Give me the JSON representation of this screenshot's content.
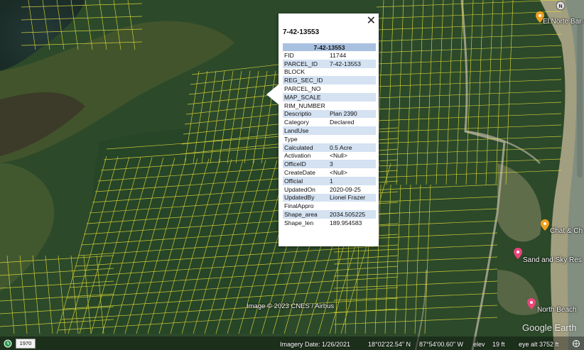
{
  "popup": {
    "title": "7-42-13553",
    "table_header": "7-42-13553",
    "close_glyph": "✕",
    "rows": [
      {
        "key": "FID",
        "value": "11744"
      },
      {
        "key": "PARCEL_ID",
        "value": "7-42-13553"
      },
      {
        "key": "BLOCK",
        "value": ""
      },
      {
        "key": "REG_SEC_ID",
        "value": ""
      },
      {
        "key": "PARCEL_NO",
        "value": ""
      },
      {
        "key": "MAP_SCALE",
        "value": ""
      },
      {
        "key": "RIM_NUMBER",
        "value": ""
      },
      {
        "key": "Descriptio",
        "value": "Plan 2390"
      },
      {
        "key": "Category",
        "value": "Declared"
      },
      {
        "key": "LandUse",
        "value": ""
      },
      {
        "key": "Type",
        "value": ""
      },
      {
        "key": "Calculated",
        "value": "0.5 Acre"
      },
      {
        "key": "Activation",
        "value": "<Null>"
      },
      {
        "key": "OfficeID",
        "value": "3"
      },
      {
        "key": "CreateDate",
        "value": "<Null>"
      },
      {
        "key": "Official",
        "value": "1"
      },
      {
        "key": "UpdatedOn",
        "value": "2020-09-25"
      },
      {
        "key": "UpdatedBy",
        "value": "Lionel Frazer"
      },
      {
        "key": "FinalAppro",
        "value": ""
      },
      {
        "key": "Shape_area",
        "value": "2034.505225"
      },
      {
        "key": "Shape_len",
        "value": "189.954583"
      }
    ]
  },
  "places": [
    {
      "name": "El Norte Bar &",
      "icon": "bar-pin-icon"
    },
    {
      "name": "Chat & Ch",
      "icon": "restaurant-pin-icon"
    },
    {
      "name": "Sand and Sky Res",
      "icon": "hotel-pin-icon"
    },
    {
      "name": "North Beach",
      "icon": "hotel-pin-icon"
    }
  ],
  "compass": {
    "north_label": "N"
  },
  "map": {
    "attribution": "Image © 2023 CNES / Airbus",
    "watermark": "Google Earth",
    "parcel_line_color": "#e8e33a",
    "pin_orange": "#f0a020",
    "pin_pink": "#e8457a"
  },
  "status": {
    "year": "1970",
    "imagery_date": "Imagery Date: 1/26/2021",
    "latitude": "18°02'22.54\" N",
    "longitude": "87°54'00.60\" W",
    "elev_label": "elev",
    "elev_value": "19 ft",
    "eye_alt": "eye alt 3752 ft"
  }
}
